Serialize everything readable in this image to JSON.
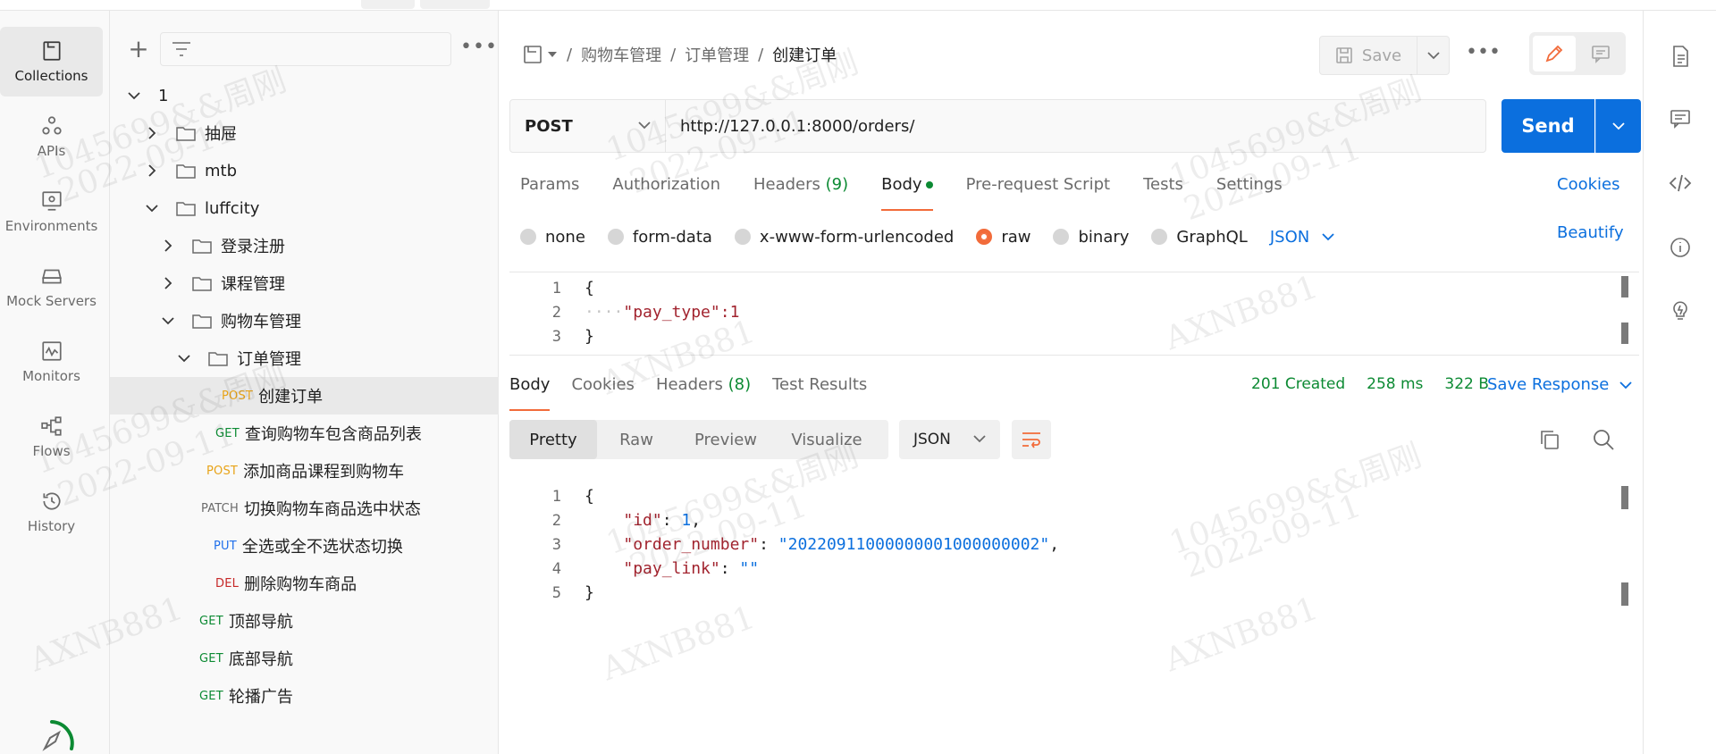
{
  "rail": {
    "items": [
      {
        "label": "Collections",
        "icon": "collections-icon"
      },
      {
        "label": "APIs",
        "icon": "apis-icon"
      },
      {
        "label": "Environments",
        "icon": "environments-icon"
      },
      {
        "label": "Mock Servers",
        "icon": "mock-servers-icon"
      },
      {
        "label": "Monitors",
        "icon": "monitors-icon"
      },
      {
        "label": "Flows",
        "icon": "flows-icon"
      },
      {
        "label": "History",
        "icon": "history-icon"
      }
    ]
  },
  "tree": {
    "rows": [
      {
        "label": "1",
        "type": "collection"
      },
      {
        "label": "抽屉",
        "type": "folder"
      },
      {
        "label": "mtb",
        "type": "folder"
      },
      {
        "label": "luffcity",
        "type": "folder"
      },
      {
        "label": "登录注册",
        "type": "folder"
      },
      {
        "label": "课程管理",
        "type": "folder"
      },
      {
        "label": "购物车管理",
        "type": "folder"
      },
      {
        "label": "订单管理",
        "type": "folder"
      },
      {
        "label": "创建订单",
        "method": "POST"
      },
      {
        "label": "查询购物车包含商品列表",
        "method": "GET"
      },
      {
        "label": "添加商品课程到购物车",
        "method": "POST"
      },
      {
        "label": "切换购物车商品选中状态",
        "method": "PATCH"
      },
      {
        "label": "全选或全不选状态切换",
        "method": "PUT"
      },
      {
        "label": "删除购物车商品",
        "method": "DEL"
      },
      {
        "label": "顶部导航",
        "method": "GET"
      },
      {
        "label": "底部导航",
        "method": "GET"
      },
      {
        "label": "轮播广告",
        "method": "GET"
      }
    ]
  },
  "header": {
    "crumbs": [
      "购物车管理",
      "订单管理",
      "创建订单"
    ],
    "save_label": "Save"
  },
  "request": {
    "method": "POST",
    "url": "http://127.0.0.1:8000/orders/",
    "send_label": "Send",
    "tabs": [
      "Params",
      "Authorization",
      "Headers",
      "Body",
      "Pre-request Script",
      "Tests",
      "Settings"
    ],
    "headers_count": "(9)",
    "cookies_label": "Cookies",
    "body_types": [
      "none",
      "form-data",
      "x-www-form-urlencoded",
      "raw",
      "binary",
      "GraphQL"
    ],
    "body_type_selected": "raw",
    "language": "JSON",
    "beautify_label": "Beautify",
    "body_lines": [
      "{",
      "\"pay_type\":1",
      "}"
    ]
  },
  "response": {
    "tabs": [
      "Body",
      "Cookies",
      "Headers",
      "Test Results"
    ],
    "headers_count": "(8)",
    "status": "201 Created",
    "time": "258 ms",
    "size": "322 B",
    "save_label": "Save Response",
    "views": [
      "Pretty",
      "Raw",
      "Preview",
      "Visualize"
    ],
    "format": "JSON",
    "lines": [
      {
        "n": "1",
        "text": "{"
      },
      {
        "n": "2",
        "key": "\"id\"",
        "value": "1",
        "trail": ","
      },
      {
        "n": "3",
        "key": "\"order_number\"",
        "value": "\"20220911000000001000000002\"",
        "trail": ","
      },
      {
        "n": "4",
        "key": "\"pay_link\"",
        "value": "\"\"",
        "trail": ""
      },
      {
        "n": "5",
        "text": "}"
      }
    ]
  },
  "watermark": {
    "lines": [
      "1045699&&周刚",
      "2022-09-11",
      "AXNB881"
    ]
  },
  "colors": {
    "accent": "#f26b3a",
    "primary": "#0b6fde",
    "success": "#0c8a33",
    "post": "#e8a317",
    "delete": "#c62828"
  }
}
